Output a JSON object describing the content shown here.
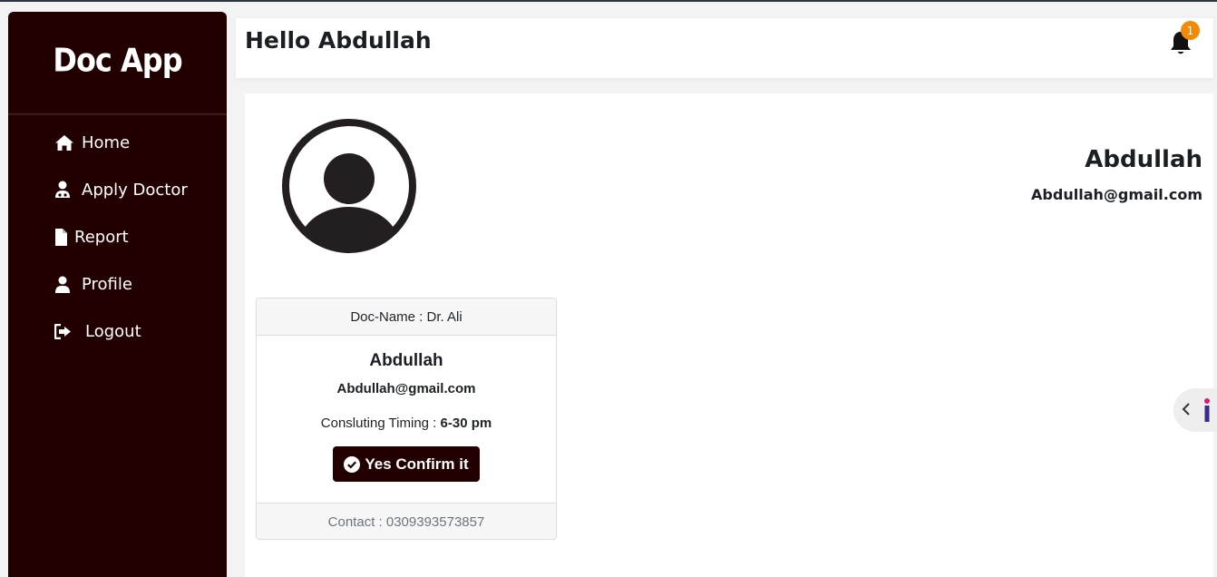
{
  "app": {
    "logo": "Doc App"
  },
  "sidebar": {
    "items": [
      {
        "label": "Home",
        "icon": "home-icon"
      },
      {
        "label": "Apply Doctor",
        "icon": "doctor-icon"
      },
      {
        "label": "Report",
        "icon": "file-icon"
      },
      {
        "label": "Profile",
        "icon": "user-icon"
      },
      {
        "label": "Logout",
        "icon": "logout-icon"
      }
    ]
  },
  "header": {
    "greeting": "Hello Abdullah",
    "notification_count": "1"
  },
  "profile": {
    "name": "Abdullah",
    "email": "Abdullah@gmail.com"
  },
  "card": {
    "header": "Doc-Name : Dr. Ali",
    "name": "Abdullah",
    "email": "Abdullah@gmail.com",
    "timing_label": "Consluting Timing :",
    "timing_value": "6-30 pm",
    "confirm_label": "Yes Confirm it",
    "footer": "Contact : 0309393573857"
  },
  "colors": {
    "sidebar_bg": "#220000",
    "badge": "#f08a07",
    "button_bg": "#220000"
  }
}
